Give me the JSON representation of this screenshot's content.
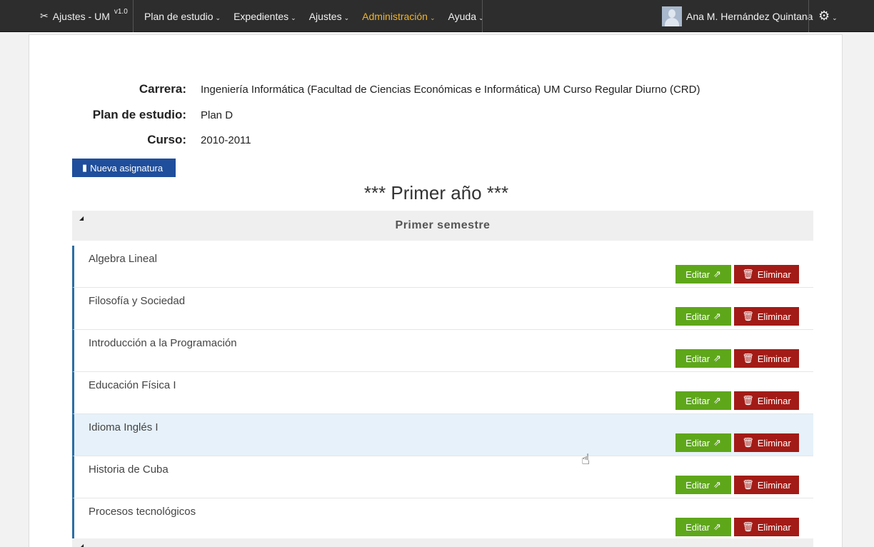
{
  "navbar": {
    "brand_icon": "scissors-icon",
    "brand": "Ajustes - UM",
    "version": "v1.0",
    "menu": [
      {
        "label": "Plan de estudio",
        "caret": "⌄"
      },
      {
        "label": "Expedientes",
        "caret": "⌄"
      },
      {
        "label": "Ajustes",
        "caret": "⌄"
      },
      {
        "label": "Administración",
        "caret": "⌄",
        "active": true
      },
      {
        "label": "Ayuda",
        "caret": "⌄"
      }
    ],
    "user_name": "Ana M. Hernández Quintana",
    "settings_icon": "gear-icon",
    "active_color": "#f0b429"
  },
  "info": {
    "carrera_label": "Carrera:",
    "carrera_value": "Ingeniería Informática (Facultad de Ciencias Económicas e Informática) UM Curso Regular Diurno (CRD)",
    "plan_label": "Plan de estudio:",
    "plan_value": "Plan D",
    "curso_label": "Curso:",
    "curso_value": "2010-2011"
  },
  "new_button": "Nueva asignatura",
  "year_title": "*** Primer año ***",
  "semester_title": "Primer semestre",
  "subjects": [
    {
      "name": "Algebra Lineal"
    },
    {
      "name": "Filosofía y Sociedad"
    },
    {
      "name": "Introducción a la Programación"
    },
    {
      "name": "Educación Física I"
    },
    {
      "name": "Idioma Inglés I"
    },
    {
      "name": "Historia de Cuba"
    },
    {
      "name": "Procesos tecnológicos"
    }
  ],
  "edit_label": "Editar",
  "delete_label": "Eliminar",
  "colors": {
    "edit": "#5ea71a",
    "delete": "#a31b16",
    "primary": "#1f4e9c",
    "row_accent": "#2a6ea5"
  }
}
